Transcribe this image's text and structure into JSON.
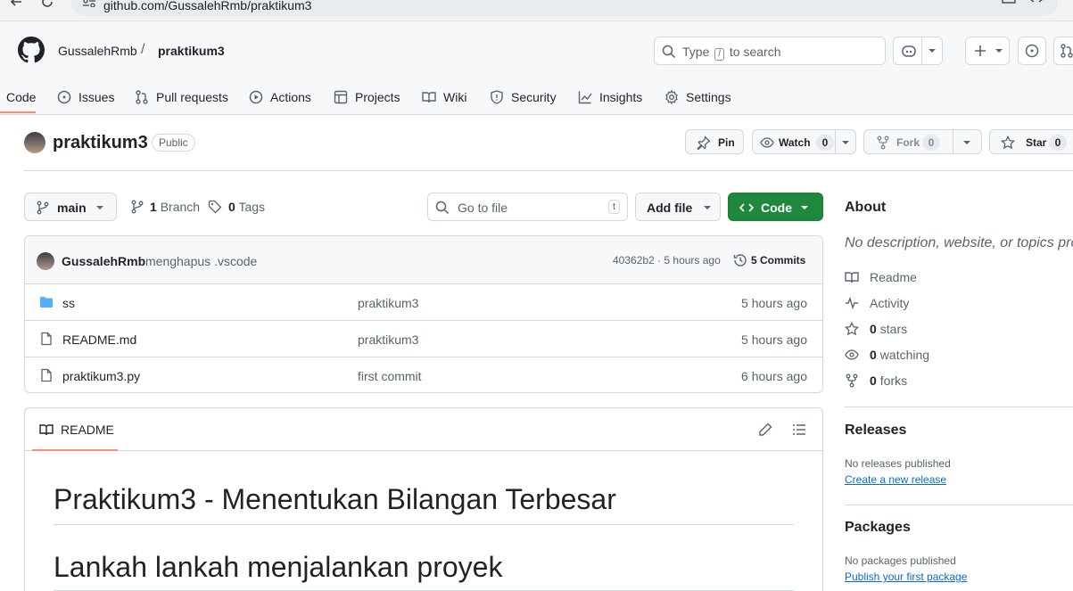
{
  "browser": {
    "url": "github.com/GussalehRmb/praktikum3"
  },
  "header": {
    "owner": "GussalehRmb",
    "separator": "/",
    "repo": "praktikum3",
    "search": {
      "before": "Type",
      "key": "/",
      "after": "to search"
    }
  },
  "tabs": [
    {
      "label": "Code",
      "icon": "code-icon"
    },
    {
      "label": "Issues",
      "icon": "issue-icon"
    },
    {
      "label": "Pull requests",
      "icon": "pull-request-icon"
    },
    {
      "label": "Actions",
      "icon": "play-icon"
    },
    {
      "label": "Projects",
      "icon": "table-icon"
    },
    {
      "label": "Wiki",
      "icon": "book-icon"
    },
    {
      "label": "Security",
      "icon": "shield-icon"
    },
    {
      "label": "Insights",
      "icon": "graph-icon"
    },
    {
      "label": "Settings",
      "icon": "gear-icon"
    }
  ],
  "repo": {
    "name": "praktikum3",
    "visibility": "Public",
    "pin": "Pin",
    "watch": {
      "label": "Watch",
      "count": "0"
    },
    "fork": {
      "label": "Fork",
      "count": "0"
    },
    "star": {
      "label": "Star",
      "count": "0"
    }
  },
  "toolbar": {
    "branch": "main",
    "branches": {
      "count": "1",
      "label": "Branch"
    },
    "tags": {
      "count": "0",
      "label": "Tags"
    },
    "goto_placeholder": "Go to file",
    "goto_key": "t",
    "add_file": "Add file",
    "code": "Code"
  },
  "latest_commit": {
    "author": "GussalehRmb",
    "message": "menghapus .vscode",
    "hash_time": "40362b2 · 5 hours ago",
    "commits": "5 Commits"
  },
  "files": [
    {
      "name": "ss",
      "type": "folder",
      "message": "praktikum3",
      "date": "5 hours ago"
    },
    {
      "name": "README.md",
      "type": "file",
      "message": "praktikum3",
      "date": "5 hours ago"
    },
    {
      "name": "praktikum3.py",
      "type": "file",
      "message": "first commit",
      "date": "6 hours ago"
    }
  ],
  "readme": {
    "tab": "README",
    "h1": "Praktikum3 - Menentukan Bilangan Terbesar",
    "h2": "Lankah lankah menjalankan proyek"
  },
  "about": {
    "title": "About",
    "description": "No description, website, or topics provided.",
    "items": [
      {
        "icon": "book-icon",
        "count": "",
        "label": "Readme"
      },
      {
        "icon": "pulse-icon",
        "count": "",
        "label": "Activity"
      },
      {
        "icon": "star-icon",
        "count": "0",
        "label": "stars"
      },
      {
        "icon": "eye-icon",
        "count": "0",
        "label": "watching"
      },
      {
        "icon": "fork-icon",
        "count": "0",
        "label": "forks"
      }
    ]
  },
  "releases": {
    "title": "Releases",
    "empty": "No releases published",
    "link": "Create a new release"
  },
  "packages": {
    "title": "Packages",
    "empty": "No packages published",
    "link": "Publish your first package"
  },
  "colors": {
    "accent_green": "#1f883d",
    "tab_underline": "#fd8c73",
    "link": "#0969da"
  }
}
